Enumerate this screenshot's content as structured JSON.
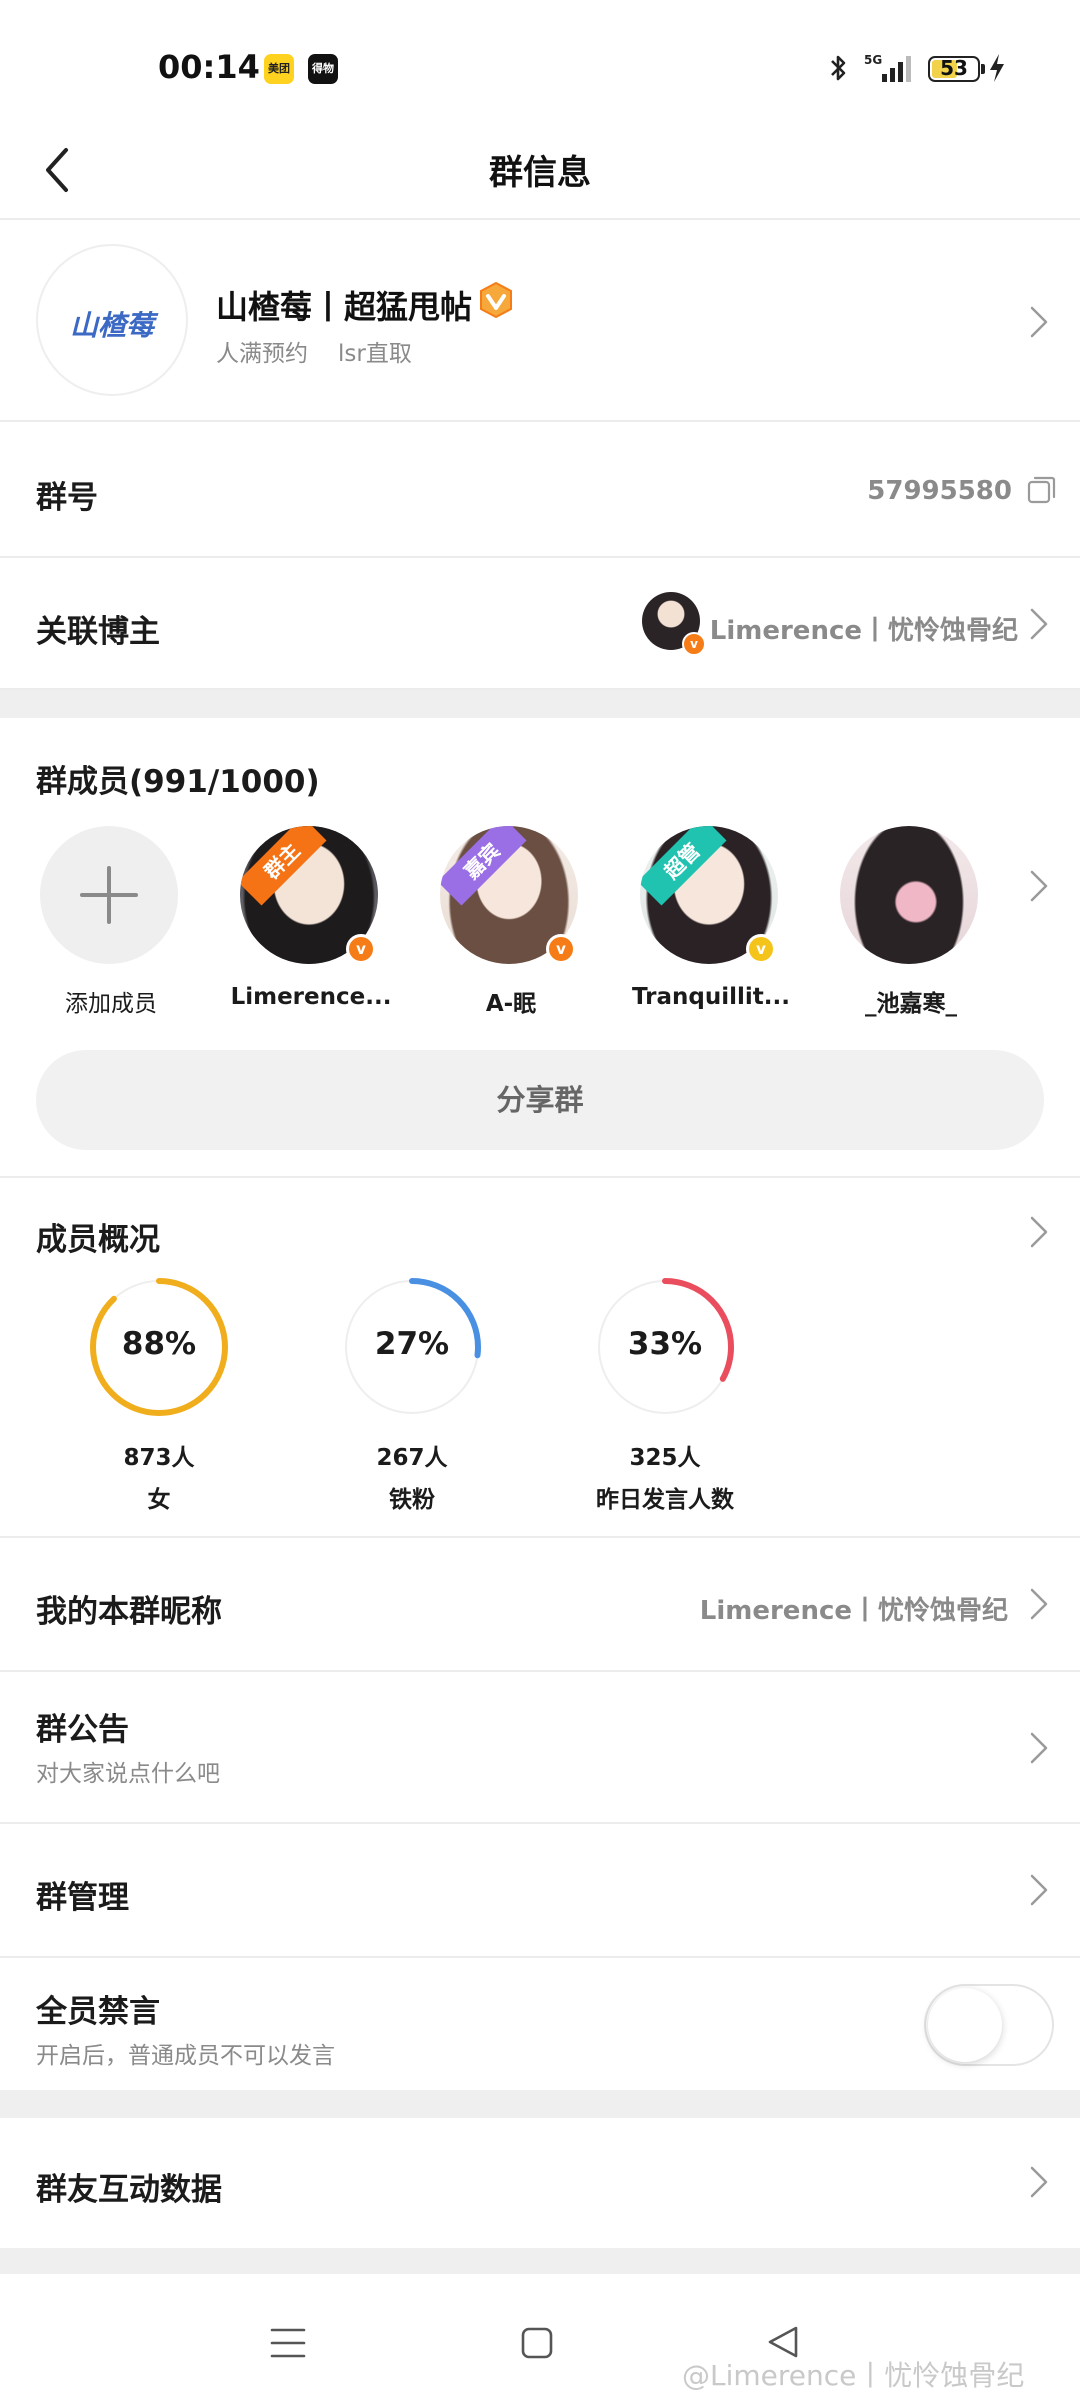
{
  "status_bar": {
    "time": "00:14",
    "app_icons": [
      "美团",
      "得物"
    ],
    "network": "5G",
    "battery": "53"
  },
  "nav": {
    "title": "群信息"
  },
  "group": {
    "avatar_text": "山楂莓",
    "name": "山楂莓丨超猛甩帖",
    "tags": [
      "人满预约",
      "lsr直取"
    ]
  },
  "rows": {
    "group_number": {
      "label": "群号",
      "value": "57995580"
    },
    "linked_blogger": {
      "label": "关联博主",
      "value": "Limerence丨忧怜蚀骨纪"
    }
  },
  "members": {
    "title": "群成员(991/1000)",
    "add_label": "添加成员",
    "items": [
      {
        "name": "Limerence...",
        "ribbon": "群主",
        "ribbon_color": "#f57314",
        "badge_color": "#f57c16"
      },
      {
        "name": "A-眠",
        "ribbon": "嘉宾",
        "ribbon_color": "#9a6fe6",
        "badge_color": "#f57c16"
      },
      {
        "name": "Tranquillit...",
        "ribbon": "超管",
        "ribbon_color": "#20c2b0",
        "badge_color": "#f5c41b"
      },
      {
        "name": "_池嘉寒_",
        "ribbon": "",
        "ribbon_color": "",
        "badge_color": ""
      }
    ],
    "share_label": "分享群"
  },
  "overview": {
    "title": "成员概况",
    "stats": [
      {
        "pct_text": "88%",
        "fraction": 0.88,
        "count": "873人",
        "label": "女",
        "color": "#f0ad1c"
      },
      {
        "pct_text": "27%",
        "fraction": 0.27,
        "count": "267人",
        "label": "铁粉",
        "color": "#4a90e2"
      },
      {
        "pct_text": "33%",
        "fraction": 0.33,
        "count": "325人",
        "label": "昨日发言人数",
        "color": "#ea4e5e"
      }
    ]
  },
  "settings": {
    "nickname": {
      "label": "我的本群昵称",
      "value": "Limerence丨忧怜蚀骨纪"
    },
    "notice": {
      "label": "群公告",
      "sub": "对大家说点什么吧"
    },
    "manage": {
      "label": "群管理"
    },
    "mute_all": {
      "label": "全员禁言",
      "sub": "开启后，普通成员不可以发言",
      "enabled": false
    },
    "interaction": {
      "label": "群友互动数据"
    }
  },
  "watermark": "@Limerence丨忧怜蚀骨纪",
  "colors": {
    "accent_orange": "#f57c16",
    "text_primary": "#1b1b1b",
    "text_secondary": "#8a8a8a",
    "divider": "#ececec",
    "section_gap": "#efefef"
  }
}
